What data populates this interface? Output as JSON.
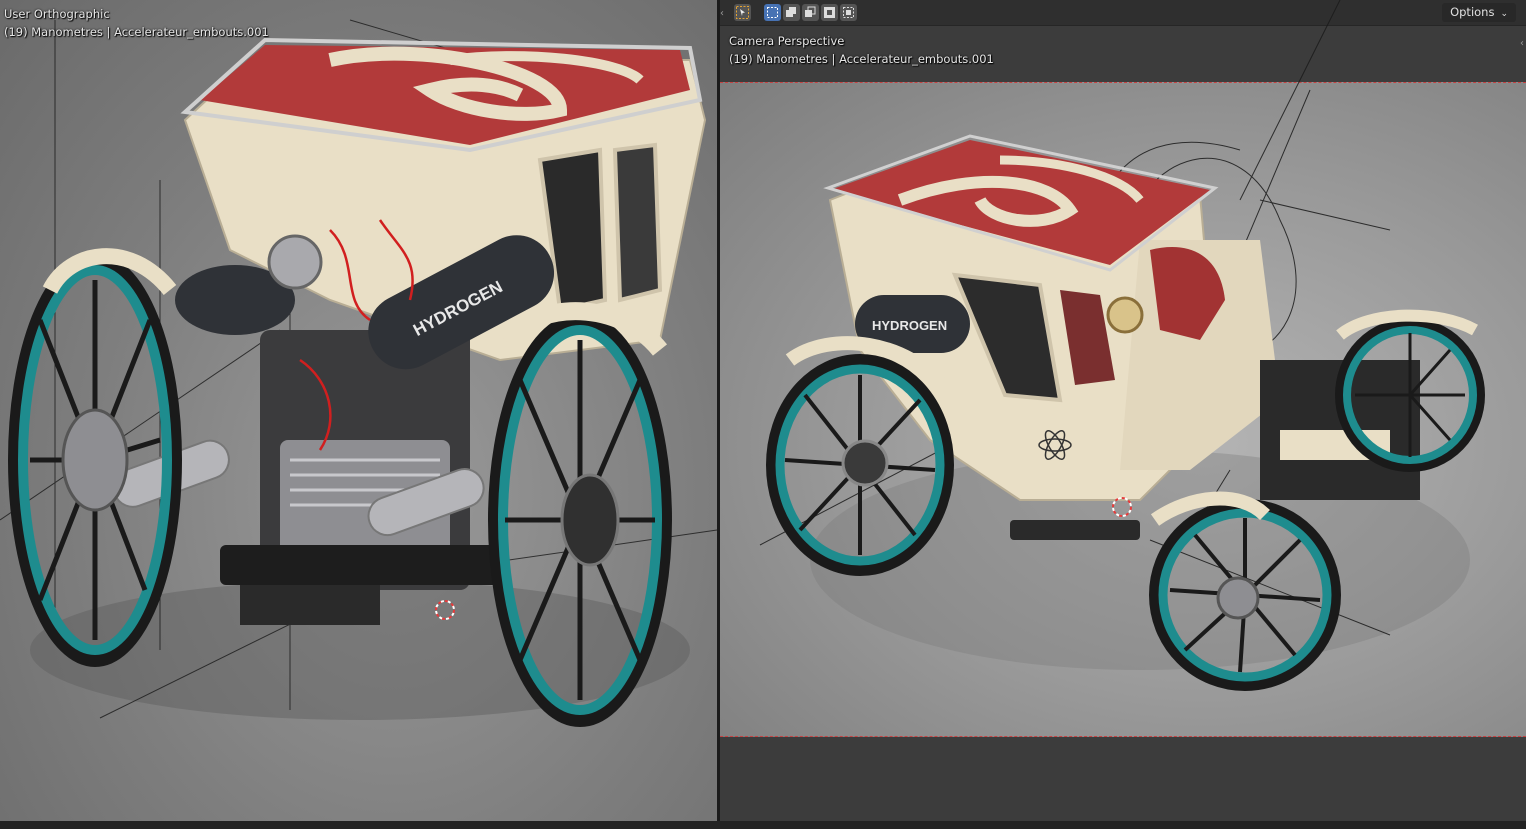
{
  "left_viewport": {
    "view_name": "User Orthographic",
    "object_info": "(19) Manometres | Accelerateur_embouts.001"
  },
  "right_viewport": {
    "view_name": "Camera Perspective",
    "object_info": "(19) Manometres | Accelerateur_embouts.001",
    "options_label": "Options",
    "select_modes": [
      "tweak",
      "select-box-new",
      "extend",
      "subtract",
      "invert",
      "intersect"
    ],
    "active_select_mode": "select-box-new"
  },
  "scene": {
    "left_label": "HYDROGEN",
    "right_label": "HYDROGEN",
    "colors": {
      "body": "#e9dfc6",
      "roof_red": "#b23a3a",
      "wheel_teal": "#1e8c8e",
      "tank": "#2f3237",
      "metal": "#a9a9ad"
    }
  }
}
